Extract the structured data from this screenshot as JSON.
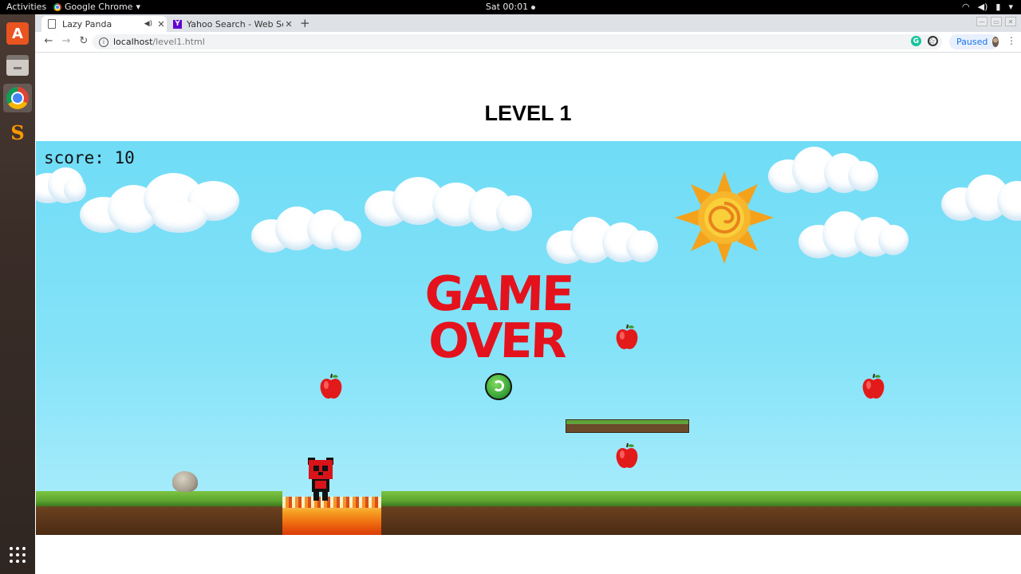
{
  "system_bar": {
    "activities": "Activities",
    "app_name": "Google Chrome",
    "clock": "Sat 00:01"
  },
  "dock": {
    "items": [
      "ubuntu-software",
      "files",
      "google-chrome",
      "sublime-text",
      "show-applications"
    ]
  },
  "browser": {
    "tabs": [
      {
        "title": "Lazy Panda",
        "active": true
      },
      {
        "title": "Yahoo Search - Web Search",
        "active": false
      }
    ],
    "url_host": "localhost",
    "url_path": "/level1.html",
    "profile_status": "Paused"
  },
  "page": {
    "title": "LEVEL 1"
  },
  "game": {
    "score_text": "score: 10",
    "game_over_line1": "GAME",
    "game_over_line2": "OVER",
    "apples_visible": 4,
    "colors": {
      "sky": "#7ddff7",
      "gameover_red": "#e4121c",
      "grass": "#5ea531",
      "dirt": "#5a3519",
      "restart_green": "#3ca83a"
    }
  }
}
